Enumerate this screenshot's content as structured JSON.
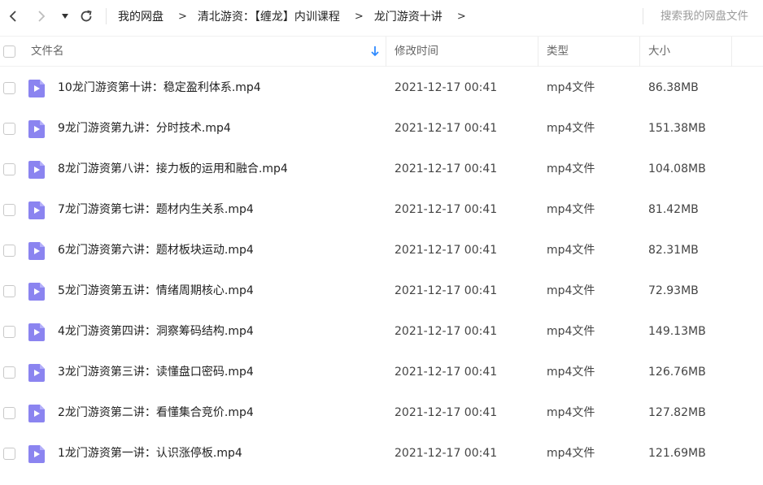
{
  "toolbar": {
    "back_icon": "chevron-left-icon",
    "forward_icon": "chevron-right-icon",
    "dropdown_icon": "caret-down-icon",
    "refresh_icon": "refresh-icon",
    "breadcrumb": [
      "我的网盘",
      "清北游资：【缠龙】内训课程",
      "龙门游资十讲"
    ],
    "breadcrumb_separator": ">",
    "search_placeholder": "搜索我的网盘文件"
  },
  "header": {
    "name": "文件名",
    "modified": "修改时间",
    "type": "类型",
    "size": "大小",
    "sort_icon": "arrow-down-icon"
  },
  "colors": {
    "file_icon": "#8b84f0",
    "sort_arrow": "#2f8bff"
  },
  "files": [
    {
      "name": "10龙门游资第十讲：稳定盈利体系.mp4",
      "modified": "2021-12-17 00:41",
      "type": "mp4文件",
      "size": "86.38MB"
    },
    {
      "name": "9龙门游资第九讲：分时技术.mp4",
      "modified": "2021-12-17 00:41",
      "type": "mp4文件",
      "size": "151.38MB"
    },
    {
      "name": "8龙门游资第八讲：接力板的运用和融合.mp4",
      "modified": "2021-12-17 00:41",
      "type": "mp4文件",
      "size": "104.08MB"
    },
    {
      "name": "7龙门游资第七讲：题材内生关系.mp4",
      "modified": "2021-12-17 00:41",
      "type": "mp4文件",
      "size": "81.42MB"
    },
    {
      "name": "6龙门游资第六讲：题材板块运动.mp4",
      "modified": "2021-12-17 00:41",
      "type": "mp4文件",
      "size": "82.31MB"
    },
    {
      "name": "5龙门游资第五讲：情绪周期核心.mp4",
      "modified": "2021-12-17 00:41",
      "type": "mp4文件",
      "size": "72.93MB"
    },
    {
      "name": "4龙门游资第四讲：洞察筹码结构.mp4",
      "modified": "2021-12-17 00:41",
      "type": "mp4文件",
      "size": "149.13MB"
    },
    {
      "name": "3龙门游资第三讲：读懂盘口密码.mp4",
      "modified": "2021-12-17 00:41",
      "type": "mp4文件",
      "size": "126.76MB"
    },
    {
      "name": "2龙门游资第二讲：看懂集合竞价.mp4",
      "modified": "2021-12-17 00:41",
      "type": "mp4文件",
      "size": "127.82MB"
    },
    {
      "name": "1龙门游资第一讲：认识涨停板.mp4",
      "modified": "2021-12-17 00:41",
      "type": "mp4文件",
      "size": "121.69MB"
    }
  ]
}
